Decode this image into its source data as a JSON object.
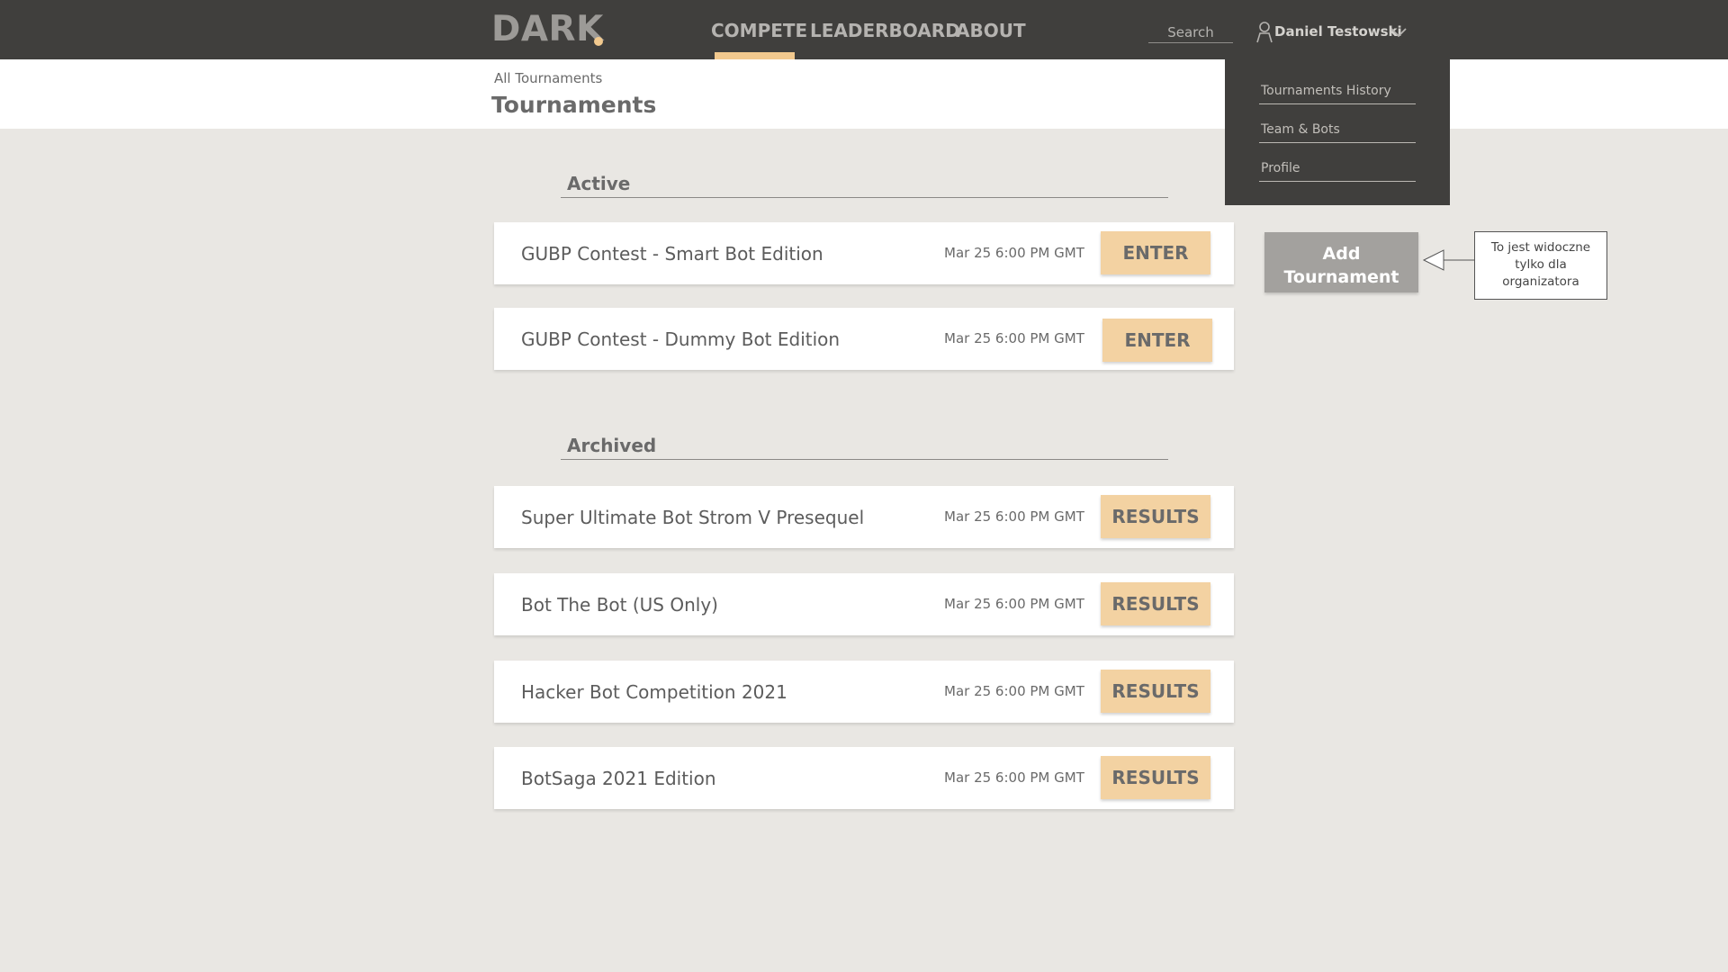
{
  "topbar": {
    "logo": "DARK",
    "nav": [
      {
        "label": "COMPETE",
        "active": true
      },
      {
        "label": "LEADERBOARD",
        "active": false
      },
      {
        "label": "ABOUT",
        "active": false
      }
    ],
    "search_placeholder": "Search",
    "user_name": "Daniel Testowski",
    "accent_color": "#f2c98e"
  },
  "dropdown": {
    "items": [
      "Tournaments History",
      "Team & Bots",
      "Profile"
    ]
  },
  "header": {
    "breadcrumb": "All Tournaments",
    "title": "Tournaments"
  },
  "sections": {
    "active": {
      "title": "Active",
      "tournaments": [
        {
          "name": "GUBP Contest - Smart Bot Edition",
          "date": "Mar 25 6:00 PM GMT",
          "action": "ENTER"
        },
        {
          "name": "GUBP Contest - Dummy Bot Edition",
          "date": "Mar 25 6:00 PM GMT",
          "action": "ENTER"
        }
      ]
    },
    "archived": {
      "title": "Archived",
      "tournaments": [
        {
          "name": "Super Ultimate Bot Strom V Presequel",
          "date": "Mar 25 6:00 PM GMT",
          "action": "RESULTS"
        },
        {
          "name": "Bot The Bot (US Only)",
          "date": "Mar 25 6:00 PM GMT",
          "action": "RESULTS"
        },
        {
          "name": "Hacker Bot Competition 2021",
          "date": "Mar 25 6:00 PM GMT",
          "action": "RESULTS"
        },
        {
          "name": "BotSaga 2021 Edition",
          "date": "Mar 25 6:00 PM GMT",
          "action": "RESULTS"
        }
      ]
    }
  },
  "add_tournament": {
    "line1": "Add",
    "line2": "Tournament"
  },
  "callout": {
    "line1": "To jest widoczne",
    "line2": "tylko dla",
    "line3": "organizatora"
  }
}
